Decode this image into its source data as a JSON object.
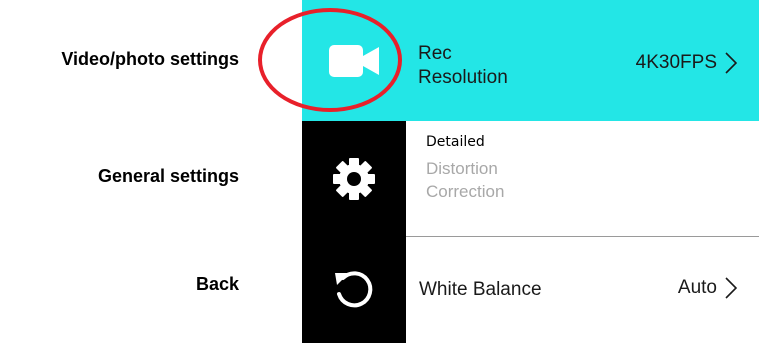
{
  "labels": {
    "video": "Video/photo settings",
    "general": "General settings",
    "back": "Back"
  },
  "sidebar": {
    "icons": [
      "video-camera-icon",
      "gear-icon",
      "back-icon"
    ]
  },
  "menu": {
    "rec": {
      "label_line1": "Rec",
      "label_line2": "Resolution",
      "value": "4K30FPS"
    },
    "distortion": {
      "annotation": "Detailed",
      "label_line1": "Distortion",
      "label_line2": "Correction"
    },
    "white_balance": {
      "label": "White Balance",
      "value": "Auto"
    }
  },
  "colors": {
    "accent": "#23e6e6",
    "highlight": "#e8202a",
    "disabled_text": "#a8a8a8"
  }
}
